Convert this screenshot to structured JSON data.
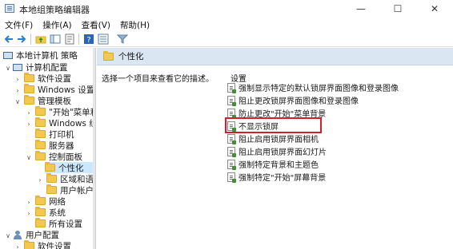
{
  "window": {
    "title": "本地组策略编辑器",
    "buttons": {
      "minimize": "—",
      "maximize": "☐",
      "close": "✕"
    }
  },
  "menu": [
    "文件(F)",
    "操作(A)",
    "查看(V)",
    "帮助(H)"
  ],
  "toolbar": {
    "icons": [
      "back-icon",
      "forward-icon",
      "up-folder-icon",
      "show-hide-tree-icon",
      "export-icon",
      "help-icon",
      "properties-icon",
      "filter-icon"
    ]
  },
  "tree": {
    "root": "本地计算机 策略",
    "computer_config": "计算机配置",
    "software_settings": "软件设置",
    "windows_settings": "Windows 设置",
    "admin_templates": "管理模板",
    "start_menu": "\"开始\"菜单和",
    "windows_components": "Windows 组",
    "printers": "打印机",
    "servers": "服务器",
    "control_panel": "控制面板",
    "personalization": "个性化",
    "regional": "区域和语",
    "user_accounts": "用户帐户",
    "network": "网络",
    "system": "系统",
    "all_settings": "所有设置",
    "user_config": "用户配置",
    "user_software_settings": "软件设置"
  },
  "main": {
    "header_title": "个性化",
    "description": "选择一个项目来查看它的描述。",
    "settings_header": "设置",
    "settings": [
      "强制显示特定的默认锁屏界面图像和登录图像",
      "阻止更改锁屏界面图像和登录图像",
      "防止更改\"开始\"菜单背景",
      "不显示锁屏",
      "阻止启用锁屏界面相机",
      "阻止启用锁屏界面幻灯片",
      "强制特定背景和主题色",
      "强制特定\"开始\"屏幕背景"
    ],
    "highlighted_index": 3,
    "highlight_color": "#d21f2a"
  }
}
